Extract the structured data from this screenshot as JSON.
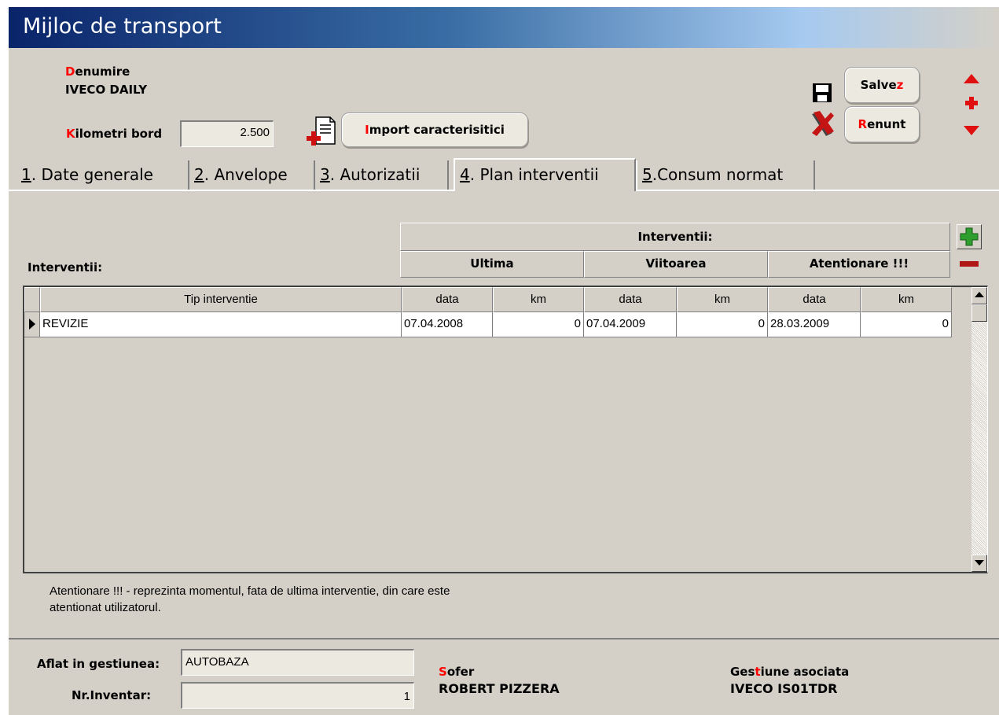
{
  "window": {
    "title": "Mijloc de transport"
  },
  "header": {
    "denumire": {
      "hotkey": "D",
      "rest": "enumire",
      "value": "IVECO DAILY"
    },
    "kilometri": {
      "hotkey": "K",
      "rest": "ilometri bord",
      "value": "2.500"
    },
    "import_button": {
      "hotkey": "I",
      "rest": "mport caracterisitici"
    },
    "save_button": {
      "main": "Salve",
      "hotkey": "z"
    },
    "cancel_button": {
      "hotkey": "R",
      "rest": "enunt"
    }
  },
  "tabs": [
    {
      "num": "1",
      "label": ". Date generale"
    },
    {
      "num": "2",
      "label": ". Anvelope"
    },
    {
      "num": "3",
      "label": ". Autorizatii"
    },
    {
      "num": "4",
      "label": ". Plan interventii"
    },
    {
      "num": "5",
      "label": ".Consum normat"
    }
  ],
  "interventii": {
    "section_label": "Interventii:",
    "group_header": "Interventii:",
    "sub_headers": [
      "Ultima",
      "Viitoarea",
      "Atentionare !!!"
    ],
    "columns": [
      "Tip interventie",
      "data",
      "km",
      "data",
      "km",
      "data",
      "km"
    ],
    "rows": [
      {
        "tip": "REVIZIE",
        "ultima_data": "07.04.2008",
        "ultima_km": "0",
        "viitoarea_data": "07.04.2009",
        "viitoarea_km": "0",
        "atentionare_data": "28.03.2009",
        "atentionare_km": "0"
      }
    ],
    "note_line1": "Atentionare !!! - reprezinta momentul, fata de ultima interventie, din care este",
    "note_line2": "atentionat utilizatorul."
  },
  "footer": {
    "gestiune_label": "Aflat in gestiunea:",
    "gestiune_value": "AUTOBAZA",
    "inventar_label": "Nr.Inventar:",
    "inventar_value": "1",
    "sofer": {
      "hotkey": "S",
      "rest": "ofer",
      "value": "ROBERT  PIZZERA"
    },
    "gestiune_asociata": {
      "before": "Ges",
      "hotkey": "t",
      "after": "iune asociata",
      "value": "IVECO IS01TDR"
    }
  },
  "colors": {
    "hotkey": "#ff0000",
    "titlebar_start": "#0a246a",
    "titlebar_end": "#d4d0c8",
    "window_bg": "#d4d0c8",
    "add_icon": "#2e9e2e",
    "remove_icon": "#b01818"
  }
}
